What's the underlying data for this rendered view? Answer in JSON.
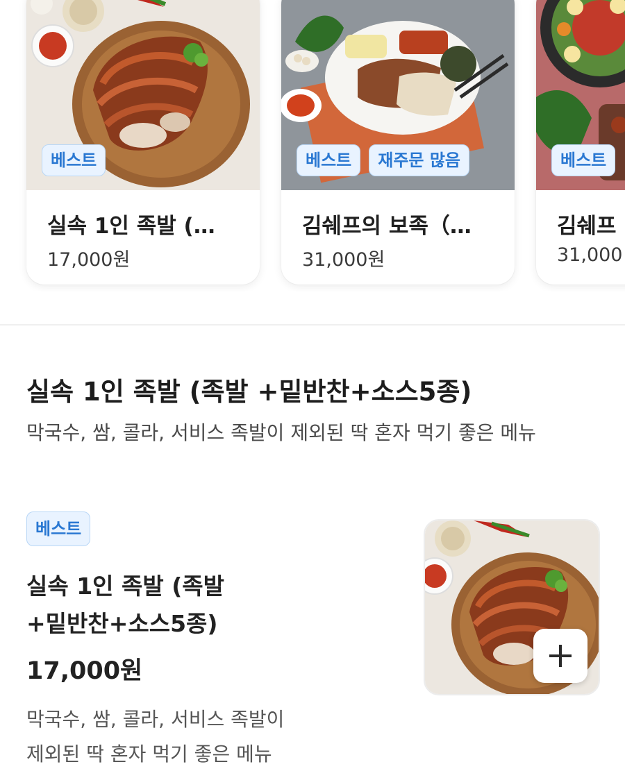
{
  "carousel": {
    "cards": [
      {
        "badges": [
          "베스트"
        ],
        "name": "실속 1인 족발 (…",
        "price": "17,000원",
        "image": "jokbal-plate"
      },
      {
        "badges": [
          "베스트",
          "재주문 많음"
        ],
        "name": "김쉐프의 보족（…",
        "price": "31,000원",
        "image": "bossam-plate"
      },
      {
        "badges": [
          "베스트"
        ],
        "name": "김쉐프",
        "price": "31,000",
        "image": "noodle-plate"
      }
    ]
  },
  "detail": {
    "title": "실속 1인 족발 (족발 +밑반찬+소스5종)",
    "description": "막국수, 쌈, 콜라, 서비스 족발이 제외된 딱 혼자 먹기 좋은 메뉴"
  },
  "item": {
    "badge": "베스트",
    "name_line1": "실속 1인 족발 (족발",
    "name_line2": "+밑반찬+소스5종)",
    "price": "17,000원",
    "desc_line1": "막국수, 쌈, 콜라, 서비스 족발이",
    "desc_line2": "제외된 딱 혼자 먹기 좋은 메뉴",
    "add_icon": "plus-icon"
  },
  "colors": {
    "badge_text": "#2a78d2",
    "badge_bg": "#e9f3ff",
    "badge_border": "#b9d7f6"
  }
}
